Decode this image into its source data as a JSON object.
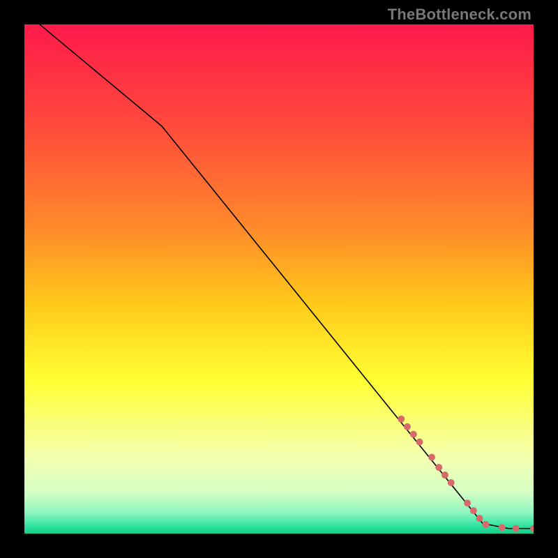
{
  "watermark": "TheBottleneck.com",
  "chart_data": {
    "type": "line",
    "title": "",
    "xlabel": "",
    "ylabel": "",
    "xlim": [
      0,
      100
    ],
    "ylim": [
      0,
      100
    ],
    "grid": false,
    "legend": false,
    "background_gradient": {
      "stops": [
        {
          "offset": 0.0,
          "color": "#ff1a4b"
        },
        {
          "offset": 0.2,
          "color": "#ff4a3b"
        },
        {
          "offset": 0.4,
          "color": "#ff8a2a"
        },
        {
          "offset": 0.55,
          "color": "#ffca1a"
        },
        {
          "offset": 0.7,
          "color": "#ffff33"
        },
        {
          "offset": 0.85,
          "color": "#f4ffb0"
        },
        {
          "offset": 0.92,
          "color": "#d3ffc4"
        },
        {
          "offset": 0.96,
          "color": "#8bf5bf"
        },
        {
          "offset": 0.985,
          "color": "#2fe3a0"
        },
        {
          "offset": 1.0,
          "color": "#17cc88"
        }
      ]
    },
    "series": [
      {
        "name": "curve",
        "color": "#000000",
        "stroke_width": 1.6,
        "points": [
          {
            "x": 3,
            "y": 100
          },
          {
            "x": 27,
            "y": 80
          },
          {
            "x": 90,
            "y": 2
          },
          {
            "x": 95,
            "y": 1
          },
          {
            "x": 100,
            "y": 1
          }
        ]
      }
    ],
    "markers": {
      "name": "highlight-points",
      "color": "#d66a6a",
      "radius": 5,
      "points": [
        {
          "x": 74.0,
          "y": 22.5
        },
        {
          "x": 75.2,
          "y": 21.0
        },
        {
          "x": 76.4,
          "y": 19.5
        },
        {
          "x": 77.6,
          "y": 18.0
        },
        {
          "x": 80.0,
          "y": 15.0
        },
        {
          "x": 81.4,
          "y": 13.0
        },
        {
          "x": 82.6,
          "y": 11.5
        },
        {
          "x": 83.8,
          "y": 10.0
        },
        {
          "x": 87.0,
          "y": 6.0
        },
        {
          "x": 88.2,
          "y": 4.5
        },
        {
          "x": 89.4,
          "y": 3.0
        },
        {
          "x": 90.6,
          "y": 1.8
        },
        {
          "x": 93.8,
          "y": 1.2
        },
        {
          "x": 96.5,
          "y": 1.0
        },
        {
          "x": 100.0,
          "y": 1.0
        }
      ]
    }
  }
}
